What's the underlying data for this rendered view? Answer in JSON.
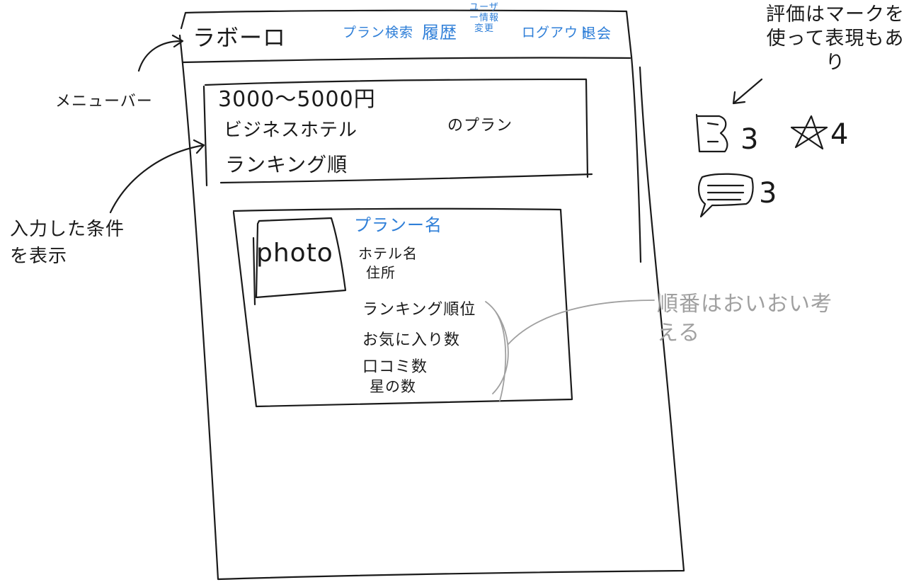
{
  "app": {
    "title": "ラボーロ"
  },
  "nav": {
    "plan_search": "プラン検索",
    "history": "履歴",
    "user_info": "ユーザー情報変更",
    "logout": "ログアウト",
    "withdraw": "退会"
  },
  "conditions": {
    "price_range": "3000～5000円",
    "hotel_type": "ビジネスホテル",
    "suffix": "のプラン",
    "order": "ランキング順"
  },
  "result_card": {
    "photo_label": "photo",
    "plan_name": "プランー名",
    "hotel_name": "ホテル名",
    "address": "住所",
    "metrics": [
      "ランキング順位",
      "お気に入り数",
      "口コミ数",
      "星の数"
    ]
  },
  "annotations": {
    "menu_bar": "メニューバー",
    "input_conditions": "入力した条件を表示",
    "rating_note": "評価はマークを使って表現もあり",
    "order_note": "順番はおいおい考える"
  },
  "rating_icons": [
    {
      "icon": "bookmark-icon",
      "value": "3"
    },
    {
      "icon": "star-icon",
      "value": "4"
    },
    {
      "icon": "speech-bubble-icon",
      "value": "3"
    }
  ],
  "colors": {
    "ink": "#1a1a1a",
    "accent": "#2f7fd8",
    "note": "#a0a0a0"
  }
}
